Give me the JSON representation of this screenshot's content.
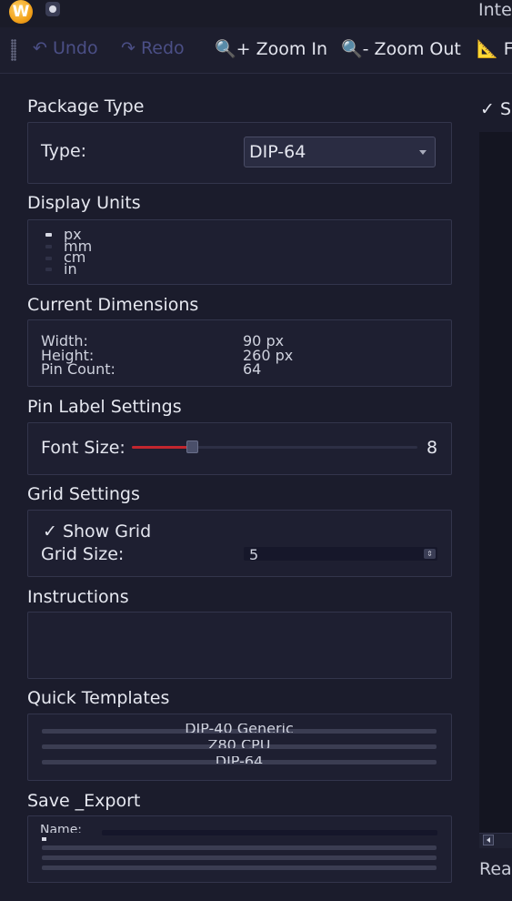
{
  "window": {
    "logo_letter": "W",
    "title": "Inte"
  },
  "toolbar": {
    "undo": "↶ Undo",
    "redo": "↷ Redo",
    "zoom_in": "🔍+ Zoom In",
    "zoom_out": "🔍- Zoom Out",
    "next": "📐 F"
  },
  "package_type": {
    "title": "Package Type",
    "type_label": "Type:",
    "type_value": "DIP-64"
  },
  "display_units": {
    "title": "Display Units",
    "options": [
      "px",
      "mm",
      "cm",
      "in"
    ],
    "selected": "px"
  },
  "current_dimensions": {
    "title": "Current Dimensions",
    "rows": [
      {
        "label": "Width:",
        "value": "90 px"
      },
      {
        "label": "Height:",
        "value": "260 px"
      },
      {
        "label": "Pin Count:",
        "value": "64"
      }
    ]
  },
  "pin_label": {
    "title": "Pin Label Settings",
    "font_label": "Font Size:",
    "font_value": "8",
    "slider_fraction": 0.21
  },
  "grid": {
    "title": "Grid Settings",
    "show_label": "✓ Show Grid",
    "size_label": "Grid Size:",
    "size_value": "5"
  },
  "instructions": {
    "title": "Instructions"
  },
  "quick_templates": {
    "title": "Quick Templates",
    "items": [
      "DIP-40 Generic",
      "Z80 CPU",
      "DIP-64"
    ]
  },
  "save_export": {
    "title": "Save _Export",
    "name_label": "Name:"
  },
  "right": {
    "show_label": "✓ S",
    "status": "Rea"
  },
  "colors": {
    "background": "#1b1c2c",
    "accent": "#c2262e",
    "panel": "#1e1f31"
  }
}
